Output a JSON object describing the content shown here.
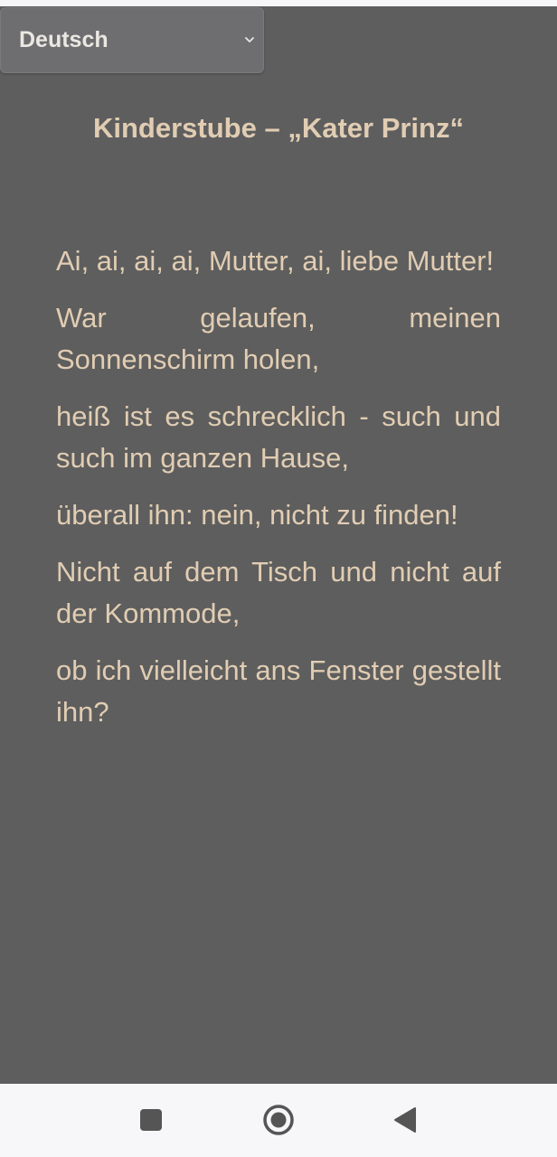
{
  "language_select": {
    "selected": "Deutsch"
  },
  "title": "Kinderstube – „Kater Prinz“",
  "poem": {
    "verses": [
      "Ai, ai, ai, ai, Mutter, ai, liebe Mutter!",
      "War gelaufen, meinen Sonnenschirm holen,",
      "heiß ist es schrecklich - such und such im ganzen Hause,",
      "überall ihn: nein, nicht zu finden!",
      "Nicht auf dem Tisch und nicht auf der Kommode,",
      "ob ich vielleicht ans Fenster gestellt ihn?"
    ]
  },
  "nav_bar": {
    "buttons": [
      {
        "name": "recents",
        "icon": "square-icon"
      },
      {
        "name": "home",
        "icon": "circle-icon"
      },
      {
        "name": "back",
        "icon": "triangle-back-icon"
      }
    ]
  },
  "colors": {
    "background": "#5e5e5e",
    "text": "#e1cdb3",
    "select_background": "#6e6e70",
    "nav_background": "#f7f7f9",
    "nav_icon": "#555555"
  }
}
